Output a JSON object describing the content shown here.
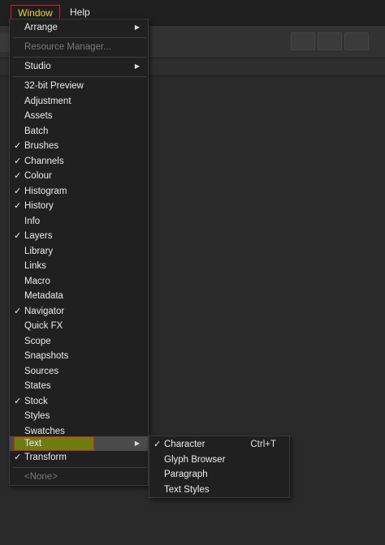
{
  "menubar": {
    "window_label": "Window",
    "help_label": "Help"
  },
  "window_menu": {
    "items": [
      {
        "label": "Arrange",
        "submenu": true,
        "checked": false,
        "enabled": true
      },
      {
        "label": "Resource Manager...",
        "submenu": false,
        "checked": false,
        "enabled": false
      },
      {
        "label": "Studio",
        "submenu": true,
        "checked": false,
        "enabled": true
      },
      {
        "label": "32-bit Preview",
        "checked": false,
        "enabled": true
      },
      {
        "label": "Adjustment",
        "checked": false,
        "enabled": true
      },
      {
        "label": "Assets",
        "checked": false,
        "enabled": true
      },
      {
        "label": "Batch",
        "checked": false,
        "enabled": true
      },
      {
        "label": "Brushes",
        "checked": true,
        "enabled": true
      },
      {
        "label": "Channels",
        "checked": true,
        "enabled": true
      },
      {
        "label": "Colour",
        "checked": true,
        "enabled": true
      },
      {
        "label": "Histogram",
        "checked": true,
        "enabled": true
      },
      {
        "label": "History",
        "checked": true,
        "enabled": true
      },
      {
        "label": "Info",
        "checked": false,
        "enabled": true
      },
      {
        "label": "Layers",
        "checked": true,
        "enabled": true
      },
      {
        "label": "Library",
        "checked": false,
        "enabled": true
      },
      {
        "label": "Links",
        "checked": false,
        "enabled": true
      },
      {
        "label": "Macro",
        "checked": false,
        "enabled": true
      },
      {
        "label": "Metadata",
        "checked": false,
        "enabled": true
      },
      {
        "label": "Navigator",
        "checked": true,
        "enabled": true
      },
      {
        "label": "Quick FX",
        "checked": false,
        "enabled": true
      },
      {
        "label": "Scope",
        "checked": false,
        "enabled": true
      },
      {
        "label": "Snapshots",
        "checked": false,
        "enabled": true
      },
      {
        "label": "Sources",
        "checked": false,
        "enabled": true
      },
      {
        "label": "States",
        "checked": false,
        "enabled": true
      },
      {
        "label": "Stock",
        "checked": true,
        "enabled": true
      },
      {
        "label": "Styles",
        "checked": false,
        "enabled": true
      },
      {
        "label": "Swatches",
        "checked": false,
        "enabled": true
      },
      {
        "label": "Text",
        "submenu": true,
        "checked": false,
        "enabled": true,
        "highlighted": true
      },
      {
        "label": "Transform",
        "checked": true,
        "enabled": true
      },
      {
        "label": "<None>",
        "checked": false,
        "enabled": false
      }
    ]
  },
  "text_submenu": {
    "items": [
      {
        "label": "Character",
        "checked": true,
        "shortcut": "Ctrl+T"
      },
      {
        "label": "Glyph Browser",
        "checked": false,
        "shortcut": ""
      },
      {
        "label": "Paragraph",
        "checked": false,
        "shortcut": ""
      },
      {
        "label": "Text Styles",
        "checked": false,
        "shortcut": ""
      }
    ]
  },
  "glyphs": {
    "check": "✓",
    "submenu_arrow": "▶"
  },
  "colors": {
    "menubar_bg": "#1f1f20",
    "menu_bg": "#202021",
    "highlight_outline": "#d21f1f",
    "active_text": "#f2d23a",
    "text_item_highlight": "#6e7d12"
  }
}
